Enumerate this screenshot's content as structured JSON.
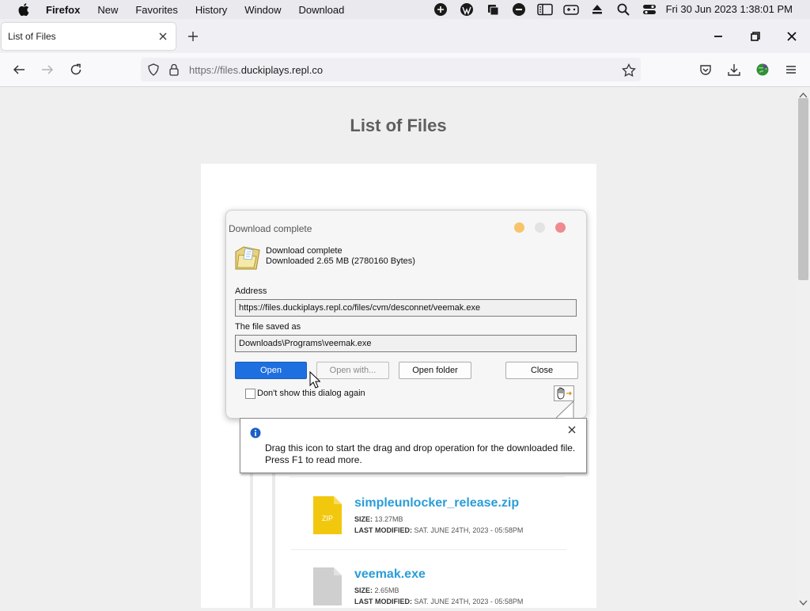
{
  "menubar": {
    "app": "Firefox",
    "items": [
      "New",
      "Favorites",
      "History",
      "Window",
      "Download"
    ],
    "clock": "Fri 30 Jun 2023  1:38:01 PM"
  },
  "tab": {
    "title": "List of Files"
  },
  "urlbar": {
    "scheme": "https://files.",
    "host": "duckiplays.repl.co"
  },
  "page": {
    "title": "List of Files",
    "files": [
      {
        "name": "simpleunlocker_release.zip",
        "size_label": "SIZE:",
        "size": "13.27MB",
        "modified_label": "LAST MODIFIED:",
        "modified": "SAT. JUNE 24TH, 2023 - 05:58PM",
        "icon_text": "ZIP"
      },
      {
        "name": "veemak.exe",
        "size_label": "SIZE:",
        "size": "2.65MB",
        "modified_label": "LAST MODIFIED:",
        "modified": "SAT. JUNE 24TH, 2023 - 05:58PM"
      }
    ]
  },
  "dialog": {
    "title": "Download complete",
    "status": "Download complete",
    "downloaded": "Downloaded 2.65  MB (2780160 Bytes)",
    "address_label": "Address",
    "address": "https://files.duckiplays.repl.co/files/cvm/desconnet/veemak.exe",
    "saved_label": "The file saved as",
    "saved_path": "Downloads\\Programs\\veemak.exe",
    "buttons": {
      "open": "Open",
      "open_with": "Open with...",
      "open_folder": "Open folder",
      "close": "Close"
    },
    "dont_show": "Don't show this dialog again",
    "dont_show_checked": false
  },
  "tooltip": {
    "line1": "Drag this icon to start the drag and drop operation for the downloaded file.",
    "line2": "Press F1 to read more."
  },
  "colors": {
    "link": "#2a9dd8",
    "primary_button": "#1e6fe0",
    "zip_icon": "#f2c80f",
    "exe_icon": "#cfcfcf"
  }
}
